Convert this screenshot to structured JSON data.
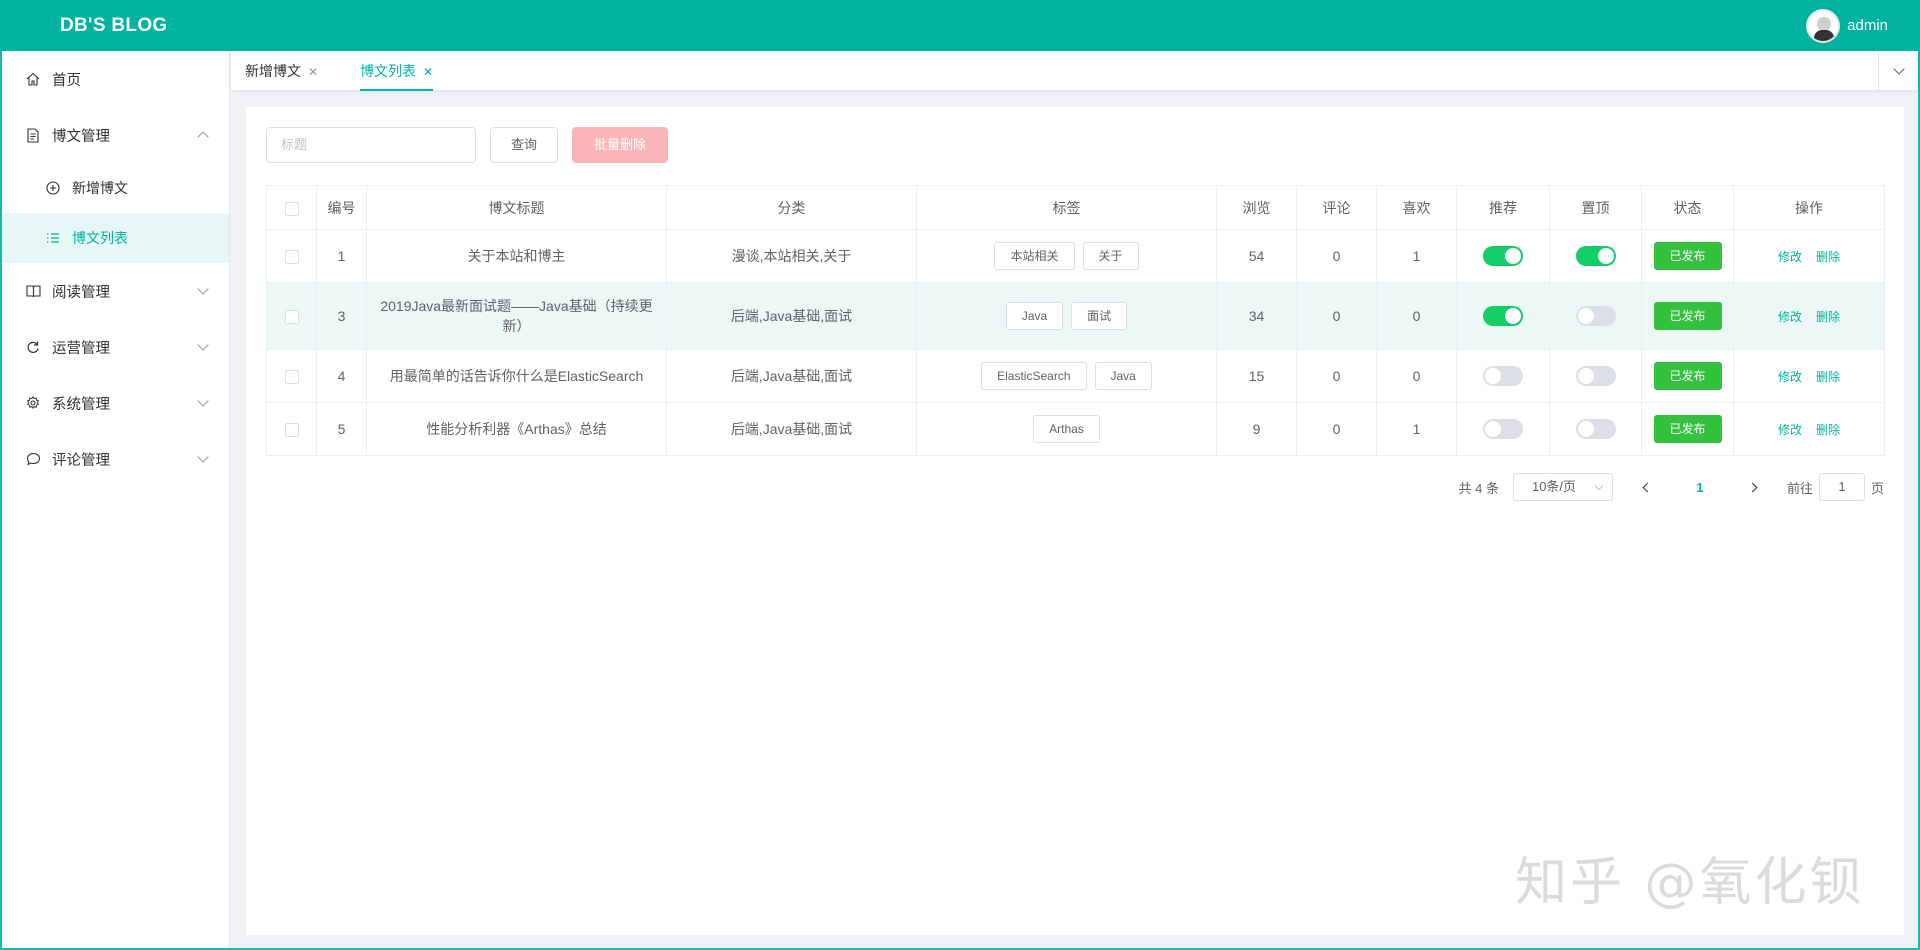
{
  "header": {
    "brand": "DB'S BLOG",
    "username": "admin"
  },
  "sidebar": {
    "home": "首页",
    "blog_mgmt": "博文管理",
    "new_post": "新增博文",
    "post_list": "博文列表",
    "read_mgmt": "阅读管理",
    "ops_mgmt": "运营管理",
    "sys_mgmt": "系统管理",
    "comment_mgmt": "评论管理"
  },
  "tabs": [
    {
      "label": "新增博文",
      "close": "✕"
    },
    {
      "label": "博文列表",
      "close": "✕"
    }
  ],
  "toolbar": {
    "search_placeholder": "标题",
    "query": "查询",
    "batch_delete": "批量删除"
  },
  "table": {
    "headers": [
      "编号",
      "博文标题",
      "分类",
      "标签",
      "浏览",
      "评论",
      "喜欢",
      "推荐",
      "置顶",
      "状态",
      "操作"
    ],
    "rows": [
      {
        "id": "1",
        "title": "关于本站和博主",
        "category": "漫谈,本站相关,关于",
        "tags": [
          "本站相关",
          "关于"
        ],
        "views": "54",
        "comments": "0",
        "likes": "1",
        "recommend": true,
        "top": true,
        "status": "已发布",
        "edit": "修改",
        "delete": "删除"
      },
      {
        "id": "3",
        "title": "2019Java最新面试题——Java基础（持续更新）",
        "category": "后端,Java基础,面试",
        "tags": [
          "Java",
          "面试"
        ],
        "views": "34",
        "comments": "0",
        "likes": "0",
        "recommend": true,
        "top": false,
        "status": "已发布",
        "edit": "修改",
        "delete": "删除"
      },
      {
        "id": "4",
        "title": "用最简单的话告诉你什么是ElasticSearch",
        "category": "后端,Java基础,面试",
        "tags": [
          "ElasticSearch",
          "Java"
        ],
        "views": "15",
        "comments": "0",
        "likes": "0",
        "recommend": false,
        "top": false,
        "status": "已发布",
        "edit": "修改",
        "delete": "删除"
      },
      {
        "id": "5",
        "title": "性能分析利器《Arthas》总结",
        "category": "后端,Java基础,面试",
        "tags": [
          "Arthas"
        ],
        "views": "9",
        "comments": "0",
        "likes": "1",
        "recommend": false,
        "top": false,
        "status": "已发布",
        "edit": "修改",
        "delete": "删除"
      }
    ]
  },
  "pagination": {
    "total": "共 4 条",
    "page_size": "10条/页",
    "current": "1",
    "goto_prefix": "前往",
    "goto_value": "1",
    "goto_suffix": "页"
  },
  "watermark": "知乎 @氧化钡"
}
